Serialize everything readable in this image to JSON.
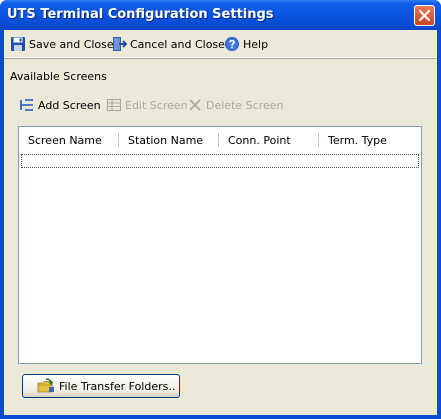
{
  "window": {
    "title": "UTS Terminal Configuration Settings"
  },
  "toolbar": {
    "save_label": "Save and Close",
    "cancel_label": "Cancel and Close",
    "help_label": "Help"
  },
  "screens": {
    "group_label": "Available Screens",
    "add_label": "Add Screen",
    "edit_label": "Edit Screen",
    "delete_label": "Delete Screen",
    "columns": [
      "Screen Name",
      "Station Name",
      "Conn. Point",
      "Term. Type"
    ]
  },
  "file_transfer_button_label": "File Transfer Folders..",
  "colors": {
    "title_bar": "#0a55e0",
    "client_bg": "#ece9d8",
    "disabled_text": "#aca899",
    "grid_border": "#7f9db9"
  }
}
